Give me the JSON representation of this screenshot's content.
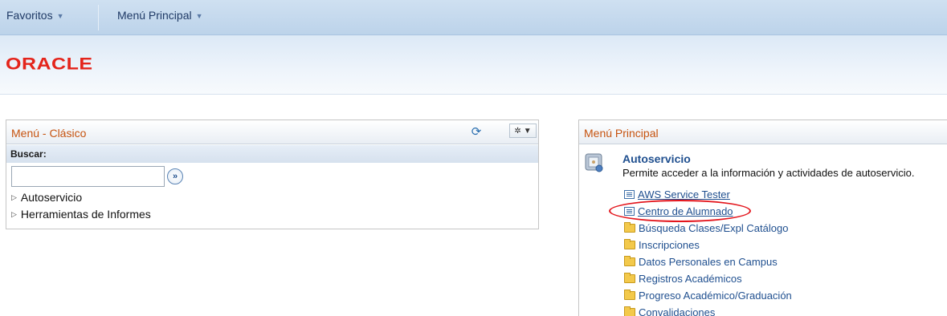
{
  "nav": {
    "favoritos": "Favoritos",
    "menu_principal": "Menú Principal"
  },
  "banner": {
    "logo": "ORACLE"
  },
  "left_pagelet": {
    "title": "Menú - Clásico",
    "refresh_icon": "refresh-icon",
    "settings_icon": "gear-icon",
    "search_label": "Buscar:",
    "search_value": "",
    "go_icon": "go-icon",
    "items": [
      {
        "label": "Autoservicio"
      },
      {
        "label": "Herramientas de Informes"
      }
    ]
  },
  "right_pagelet": {
    "title": "Menú Principal",
    "section_title": "Autoservicio",
    "section_desc": "Permite acceder a la información y actividades de autoservicio.",
    "links": [
      {
        "label": "AWS Service Tester",
        "icon": "document-icon"
      },
      {
        "label": "Centro de Alumnado",
        "icon": "document-icon",
        "highlighted": true
      },
      {
        "label": "Búsqueda Clases/Expl Catálogo",
        "icon": "folder-icon"
      },
      {
        "label": "Inscripciones",
        "icon": "folder-icon"
      },
      {
        "label": "Datos Personales en Campus",
        "icon": "folder-icon"
      },
      {
        "label": "Registros Académicos",
        "icon": "folder-icon"
      },
      {
        "label": "Progreso Académico/Graduación",
        "icon": "folder-icon"
      },
      {
        "label": "Convalidaciones",
        "icon": "folder-icon"
      }
    ],
    "highlight_color": "#e3151c"
  },
  "colors": {
    "oracle_red": "#e4241b",
    "title_orange": "#c6530f",
    "link_blue": "#1f4f8f"
  }
}
